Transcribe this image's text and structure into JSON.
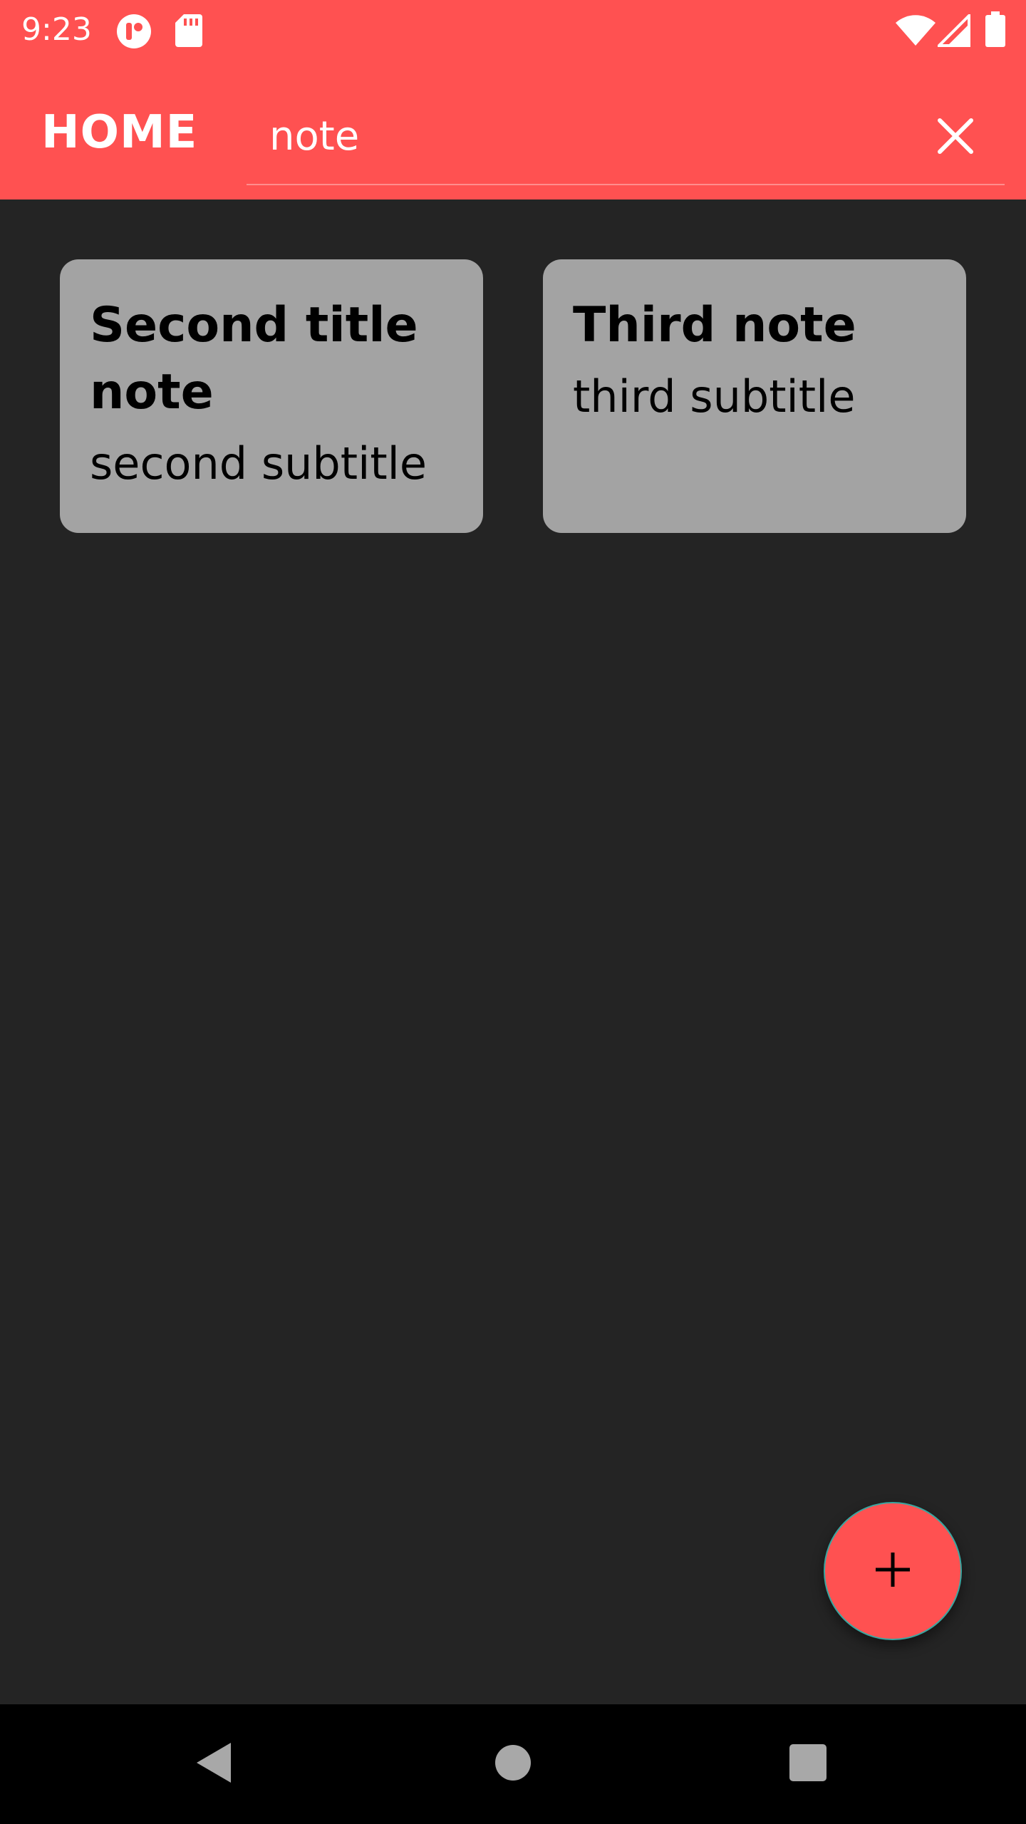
{
  "status_bar": {
    "time": "9:23",
    "icons": [
      "assistant-icon",
      "sd-card-icon",
      "wifi-icon",
      "signal-icon",
      "battery-icon"
    ]
  },
  "app_bar": {
    "title": "HOME",
    "search": {
      "value": "note",
      "placeholder": ""
    },
    "close_icon": "close-icon"
  },
  "notes": [
    {
      "title": "Second title note",
      "subtitle": "second subtitle"
    },
    {
      "title": "Third note",
      "subtitle": "third subtitle"
    }
  ],
  "fab": {
    "icon": "plus-icon"
  },
  "navigation": {
    "buttons": [
      "back-icon",
      "home-icon",
      "recents-icon"
    ]
  },
  "colors": {
    "accent": "#ff5151",
    "background": "#242424",
    "card": "#a3a3a3",
    "nav_bar": "#000000"
  }
}
